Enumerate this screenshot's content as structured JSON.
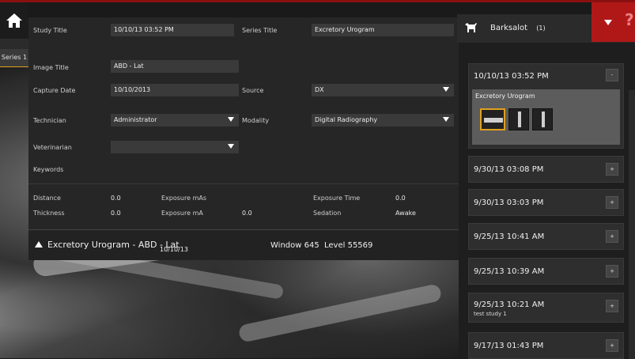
{
  "left_rail": {
    "series_tab": "Series 1"
  },
  "meta": {
    "study_title_label": "Study Title",
    "study_title_value": "10/10/13 03:52 PM",
    "series_title_label": "Series Title",
    "series_title_value": "Excretory Urogram",
    "image_title_label": "Image Title",
    "image_title_value": "ABD - Lat",
    "capture_date_label": "Capture Date",
    "capture_date_value": "10/10/2013",
    "source_label": "Source",
    "source_value": "DX",
    "technician_label": "Technician",
    "technician_value": "Administrator",
    "modality_label": "Modality",
    "modality_value": "Digital Radiography",
    "veterinarian_label": "Veterinarian",
    "veterinarian_value": "",
    "keywords_label": "Keywords",
    "distance_label": "Distance",
    "distance_value": "0.0",
    "exposure_mas_label": "Exposure mAs",
    "exposure_time_label": "Exposure Time",
    "exposure_time_value": "0.0",
    "thickness_label": "Thickness",
    "thickness_value": "0.0",
    "exposure_ma_label": "Exposure mA",
    "exposure_ma_value": "0.0",
    "sedation_label": "Sedation",
    "sedation_value": "Awake"
  },
  "infobar": {
    "caption": "Excretory Urogram - ABD - Lat",
    "date": "10/10/13",
    "window": "Window 645",
    "level": "Level 55569"
  },
  "patient": {
    "name": "Barksalot",
    "count": "(1)"
  },
  "studies": [
    {
      "date": "10/10/13 03:52 PM",
      "button": "-",
      "series_title": "Excretory Urogram"
    },
    {
      "date": "9/30/13 03:08 PM",
      "button": "+"
    },
    {
      "date": "9/30/13 03:03 PM",
      "button": "+"
    },
    {
      "date": "9/25/13 10:41 AM",
      "button": "+"
    },
    {
      "date": "9/25/13 10:39 AM",
      "button": "+"
    },
    {
      "date": "9/25/13 10:21 AM",
      "button": "+",
      "note": "test study 1"
    },
    {
      "date": "9/17/13 01:43 PM",
      "button": "+"
    }
  ],
  "colors": {
    "accent": "#e0a020",
    "brand_red": "#b01818"
  }
}
